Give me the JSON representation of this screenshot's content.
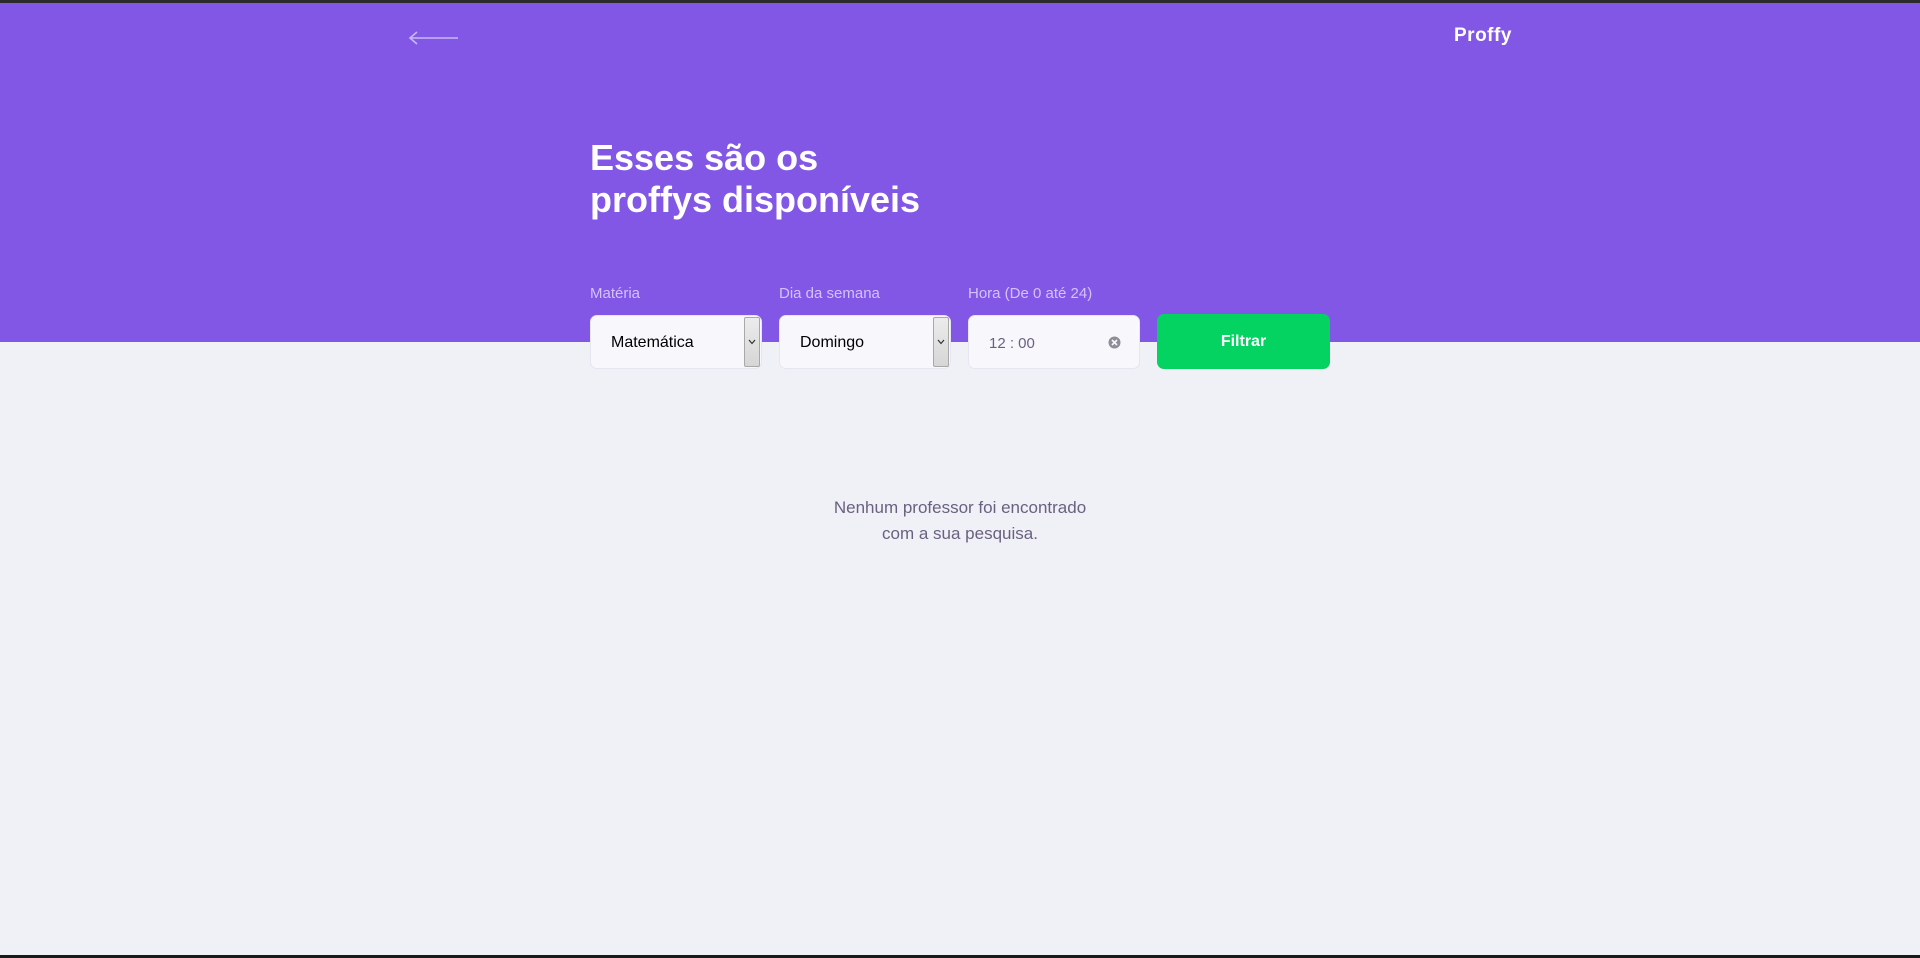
{
  "app": {
    "logo": "Proffy",
    "back_icon": "arrow-left-icon"
  },
  "page": {
    "title_line1": "Esses são os",
    "title_line2": "proffys disponíveis"
  },
  "filters": {
    "subject": {
      "label": "Matéria",
      "value": "Matemática"
    },
    "weekday": {
      "label": "Dia da semana",
      "value": "Domingo"
    },
    "time": {
      "label": "Hora (De 0 até 24)",
      "value": "12 : 00"
    },
    "submit_label": "Filtrar"
  },
  "results": {
    "empty_line1": "Nenhum professor foi encontrado",
    "empty_line2": "com a sua pesquisa."
  },
  "colors": {
    "primary": "#8257e5",
    "secondary": "#04d361",
    "background": "#f0f0f7",
    "text_muted": "#6a6180"
  }
}
